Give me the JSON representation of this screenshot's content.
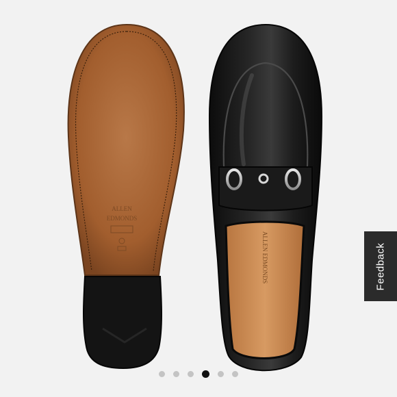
{
  "gallery": {
    "images": [
      {
        "subject": "loafer-sole"
      },
      {
        "subject": "loafer-top"
      }
    ],
    "sole_stamp": [
      "ALLEN",
      "EDMONDS"
    ],
    "insole_stamp": "ALLEN EDMONDS",
    "pagination": {
      "total": 6,
      "active_index": 3
    }
  },
  "feedback": {
    "label": "Feedback"
  },
  "colors": {
    "background": "#f2f2f2",
    "sole_leather": "#a86434",
    "heel_rubber": "#141414",
    "upper_leather": "#151515",
    "insole": "#c98a52",
    "feedback_bg": "#2b2b2b",
    "dot_active": "#111111",
    "dot_inactive": "#c4c4c4"
  }
}
